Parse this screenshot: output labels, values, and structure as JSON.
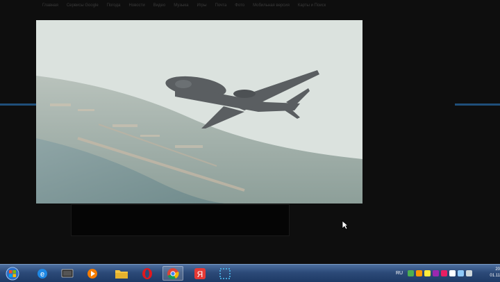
{
  "topnav": {
    "items": [
      "Главная",
      "Сервисы Google",
      "Погода",
      "Новости",
      "Видео",
      "Музыка",
      "Игры",
      "Почта",
      "Фото",
      "Мобильная версия",
      "Карты и Поиск"
    ]
  },
  "page": {
    "caption": "",
    "small_label": ""
  },
  "taskbar": {
    "apps": [
      {
        "name": "ie-icon"
      },
      {
        "name": "media-center-icon"
      },
      {
        "name": "media-player-icon"
      },
      {
        "name": "file-explorer-icon"
      },
      {
        "name": "opera-icon"
      },
      {
        "name": "chrome-icon"
      },
      {
        "name": "yandex-browser-icon"
      },
      {
        "name": "screenshot-tool-icon"
      }
    ],
    "lang": "RU",
    "clock_time": "20",
    "clock_date": "01.11"
  },
  "colors": {
    "taskbar": "#2c4a78",
    "accent_line": "#1f4f7a",
    "sky": "#d9e0dc"
  }
}
